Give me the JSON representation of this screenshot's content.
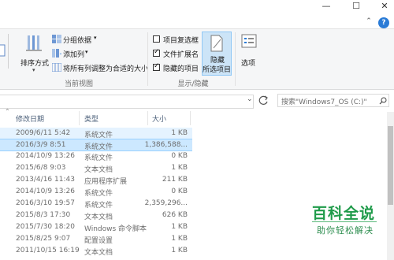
{
  "window": {
    "minimize_glyph": "—",
    "maximize_glyph": "☐",
    "close_glyph": "✕",
    "help_glyph": "?",
    "collapse_glyph": "⌃"
  },
  "ribbon": {
    "current_view": {
      "sort_label": "排序方式",
      "group_by_label": "分组依据",
      "add_column_label": "添加列",
      "fit_columns_label": "将所有列调整为合适的大小",
      "group_label": "当前视图"
    },
    "show_hide": {
      "item_checkboxes": {
        "label": "项目复选框",
        "checked": false
      },
      "file_extensions": {
        "label": "文件扩展名",
        "checked": true
      },
      "hidden_items": {
        "label": "隐藏的项目",
        "checked": true
      },
      "hide_selected_line1": "隐藏",
      "hide_selected_line2": "所选项目",
      "group_label": "显示/隐藏"
    },
    "options_label": "选项"
  },
  "address_bar": {
    "refresh_icon": "refresh-icon",
    "chevron": "⌄",
    "search_placeholder": "搜索\"Windows7_OS (C:)\""
  },
  "file_list": {
    "columns": {
      "date": "修改日期",
      "type": "类型",
      "size": "大小"
    },
    "sort_arrow": "⌃",
    "rows": [
      {
        "date": "2009/6/11 5:42",
        "type": "系统文件",
        "size": "1 KB",
        "selected": false,
        "highlight": true
      },
      {
        "date": "2016/3/9 8:51",
        "type": "系统文件",
        "size": "1,386,588...",
        "selected": true
      },
      {
        "date": "2014/10/9 13:26",
        "type": "系统文件",
        "size": "0 KB"
      },
      {
        "date": "2015/6/8 9:03",
        "type": "文本文档",
        "size": "1 KB"
      },
      {
        "date": "2013/4/16 11:43",
        "type": "应用程序扩展",
        "size": "211 KB"
      },
      {
        "date": "2014/10/9 13:26",
        "type": "系统文件",
        "size": "0 KB"
      },
      {
        "date": "2016/3/10 19:57",
        "type": "系统文件",
        "size": "2,359,296..."
      },
      {
        "date": "2015/8/3 17:30",
        "type": "文本文档",
        "size": "626 KB"
      },
      {
        "date": "2015/7/30 18:20",
        "type": "Windows 命令脚本",
        "size": "1 KB"
      },
      {
        "date": "2015/8/25 9:07",
        "type": "配置设置",
        "size": "1 KB"
      },
      {
        "date": "2011/10/15 16:19",
        "type": "文本文档",
        "size": "1 KB"
      }
    ]
  },
  "watermark": {
    "title": "百科全说",
    "subtitle": "助你轻松解决"
  },
  "colors": {
    "accent": "#cce8ff",
    "watermark": "#1f9b4a"
  }
}
